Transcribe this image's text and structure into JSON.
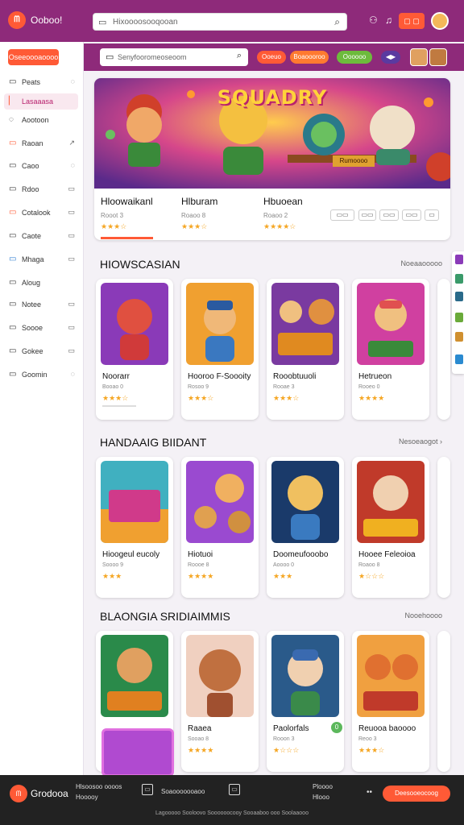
{
  "topbar": {
    "logo_text": "ᗰ",
    "app_name": "Ooboo!",
    "search_placeholder": "Hixoooosooqooan",
    "button_label": "▢ ▢"
  },
  "sidebar": {
    "button_label": "Oseeoooaoooo",
    "items": [
      {
        "label": "Peats",
        "icon": "▭",
        "chevron": "◌"
      },
      {
        "label": "Lasaaasa",
        "icon": "",
        "chevron": ""
      },
      {
        "label": "Aootoon",
        "icon": "◌",
        "chevron": ""
      },
      {
        "label": "Raoan",
        "icon": "▭",
        "chevron": "↗"
      },
      {
        "label": "Caoo",
        "icon": "▭",
        "chevron": "◌"
      },
      {
        "label": "Rdoo",
        "icon": "▭",
        "chevron": "▭"
      },
      {
        "label": "Cotalook",
        "icon": "▭",
        "chevron": "▭"
      },
      {
        "label": "Caote",
        "icon": "▭",
        "chevron": "▭"
      },
      {
        "label": "Mhaga",
        "icon": "▭",
        "chevron": "▭"
      },
      {
        "label": "Aloug",
        "icon": "▭",
        "chevron": ""
      },
      {
        "label": "Notee",
        "icon": "▭",
        "chevron": "▭"
      },
      {
        "label": "Soooe",
        "icon": "▭",
        "chevron": "▭"
      },
      {
        "label": "Gokee",
        "icon": "▭",
        "chevron": "▭"
      },
      {
        "label": "Goomin",
        "icon": "▭",
        "chevron": "◌"
      }
    ]
  },
  "toolbar": {
    "search_placeholder": "Senyfooromeoseoom",
    "chips": [
      "Ooeuo",
      "Boaoooroo",
      "Oooooo",
      "◀▶"
    ]
  },
  "hero": {
    "title": "SQUADRY",
    "sign": "Rumoooo",
    "items": [
      {
        "title": "Hloowaikanl",
        "sub": "Rooot 3",
        "rating": "★★★☆"
      },
      {
        "title": "Hlburam",
        "sub": "Roaoo 8",
        "rating": "★★★☆"
      },
      {
        "title": "Hbuoean",
        "sub": "Roaoo 2",
        "rating": "★★★★☆"
      }
    ],
    "buttons": [
      "▭▭",
      "▭▭",
      "▭▭",
      "▭▭",
      "▭"
    ]
  },
  "sections": [
    {
      "title": "HIOWSCASIAN",
      "more": "Noeaaooooo",
      "cards": [
        {
          "title": "Noorarr",
          "sub": "Booao 0",
          "rating": "★★★☆"
        },
        {
          "title": "Hooroo F-Soooity",
          "sub": "Rosoo 9",
          "rating": "★★★☆"
        },
        {
          "title": "Rooobtuuoli",
          "sub": "Rooae 3",
          "rating": "★★★☆"
        },
        {
          "title": "Hetrueon",
          "sub": "Rooeo 0",
          "rating": "★★★★"
        }
      ]
    },
    {
      "title": "HANDAAIG BIIDANT",
      "more": "Nesoeaogot ›",
      "cards": [
        {
          "title": "Hioogeul eucoly",
          "sub": "Soooo 9",
          "rating": "★★★"
        },
        {
          "title": "Hiotuoi",
          "sub": "Roooe 8",
          "rating": "★★★★"
        },
        {
          "title": "Doomeufooobo",
          "sub": "Aoooo 0",
          "rating": "★★★"
        },
        {
          "title": "Hooee Feleoioa",
          "sub": "Roaoo 8",
          "rating": "★☆☆☆"
        }
      ]
    },
    {
      "title": "BLAONGIA SRIDIAIMMIS",
      "more": "Nooehoooo",
      "cards": [
        {
          "title": "",
          "sub": "",
          "rating": ""
        },
        {
          "title": "Raaea",
          "sub": "Sooao 8",
          "rating": "★★★★"
        },
        {
          "title": "Paolorfals",
          "sub": "Rooon 3",
          "rating": "★☆☆☆",
          "badge": "0"
        },
        {
          "title": "Reuooa baoooo",
          "sub": "Reoo 3",
          "rating": "★★★☆"
        }
      ]
    }
  ],
  "footer": {
    "logo_text": "ᗰ",
    "name": "Grodooa",
    "text1": "Hlsoosoo oooos",
    "text2": "Hooooy",
    "text3": "Soaooooooaoo",
    "text4": "Ploooo",
    "text5": "Hlooo",
    "button": "Deesooeocoog",
    "copyright": "Lagooooo Sooloovo Soooooocooy Sooaaboo ooo Soolaaooo"
  },
  "colors": {
    "brand": "#8e2a7a",
    "accent": "#ff5a36"
  }
}
